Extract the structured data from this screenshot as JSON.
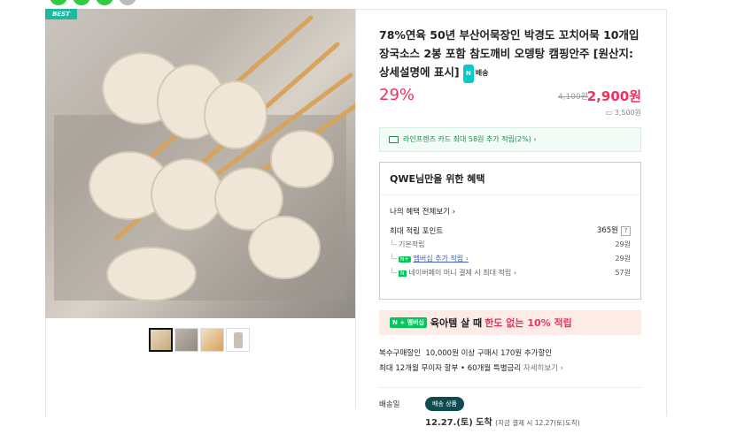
{
  "gallery": {
    "badge": "BEST"
  },
  "product": {
    "title": "78%연육 50년 부산어묵장인 박경도 꼬치어묵 10개입 장국소스 2봉 포함 참도깨비 오뎅탕 캠핑안주 [원산지: 상세설명에 표시]",
    "ship_tag": "배송",
    "discount": "29%",
    "original_price": "4,100원",
    "sale_price": "2,900원",
    "sub_price": "3,500원"
  },
  "card_promo": "라인프렌즈 카드 최대 58원 추가 적립(2%) ›",
  "benefits": {
    "heading": "QWE님만을 위한 혜택",
    "view_all": "나의 혜택 전체보기 ›",
    "max_points_label": "최대 적립 포인트",
    "max_points_value": "365원",
    "help": "?",
    "rows": [
      {
        "label": "기본적립",
        "value": "29원"
      },
      {
        "label": "멤버십 추가 적립 ›",
        "value": "29원"
      },
      {
        "label": "네이버페이 머니 결제 시 최대 적립 ›",
        "value": "57원"
      }
    ]
  },
  "promo_banner": {
    "badge": "N + 멤버십",
    "text": "육아템 살 때",
    "highlight": "한도 없는 10% 적립"
  },
  "multi_discount": {
    "line1_label": "복수구매할인",
    "line1_text": "10,000원 이상 구매시 170원 추가할인",
    "line2_text": "최대 12개월 무이자 할부 • 60개월 특별금리",
    "line2_link": "자세히보기 ›"
  },
  "shipping": {
    "label": "배송일",
    "badge": "배송 상품",
    "date": "12.27.(토) 도착",
    "date_note": "(지금 결제 시 12.27(토)도착)"
  }
}
